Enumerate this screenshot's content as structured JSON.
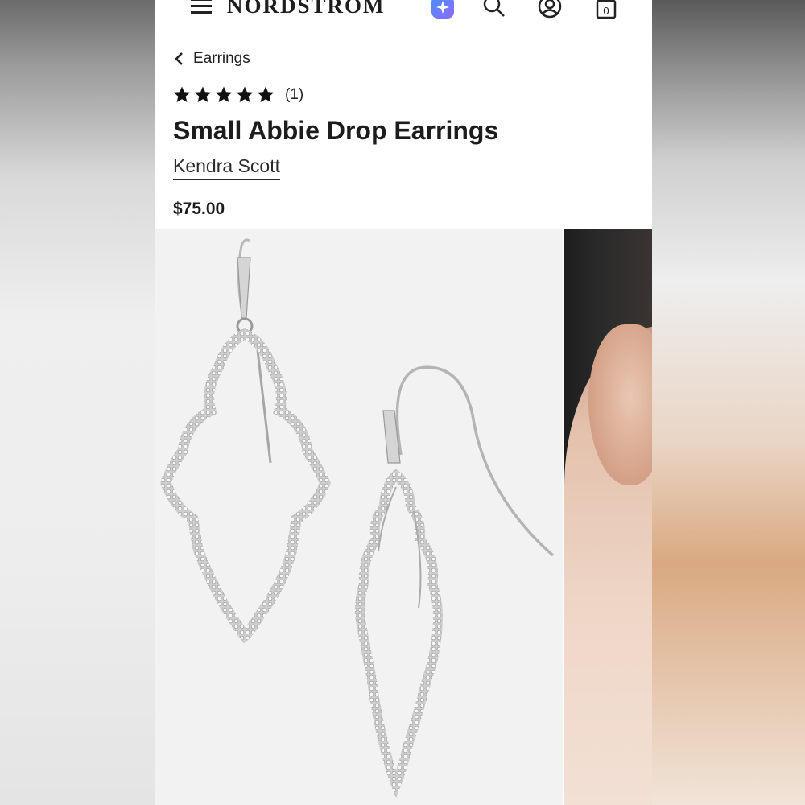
{
  "header": {
    "logo_text": "NORDSTROM",
    "icons": [
      "menu-icon",
      "ai-sparkle-icon",
      "search-icon",
      "account-icon",
      "shopping-bag-icon"
    ],
    "bag_count": "0"
  },
  "breadcrumb": {
    "label": "Earrings"
  },
  "product": {
    "rating_stars": 5,
    "review_count": "(1)",
    "title": "Small Abbie Drop Earrings",
    "brand": "Kendra Scott",
    "price": "$75.00"
  },
  "colors": {
    "text": "#1c1c1c",
    "ai_icon_gradient_start": "#4a8ef7",
    "ai_icon_gradient_end": "#8d6bff",
    "photo_background": "#f2f2f2"
  }
}
